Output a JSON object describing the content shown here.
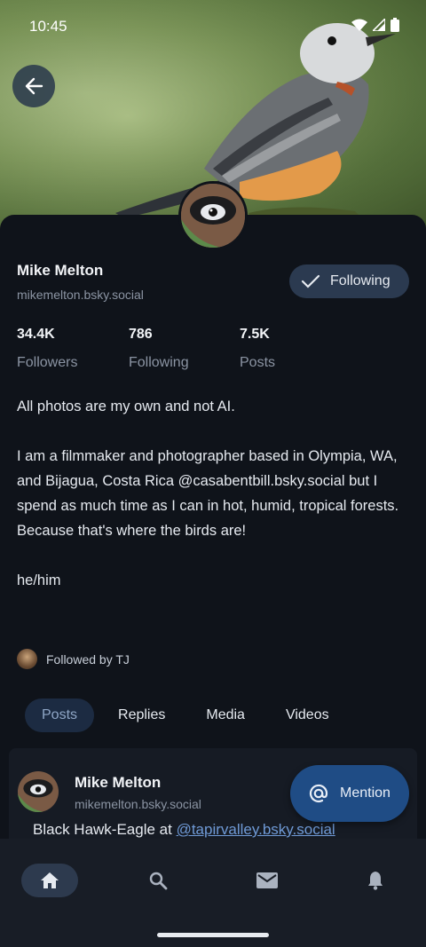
{
  "status_bar": {
    "time": "10:45"
  },
  "profile": {
    "name": "Mike Melton",
    "handle": "mikemelton.bsky.social",
    "follow_button_label": "Following",
    "stats": [
      {
        "value": "34.4K",
        "label": "Followers"
      },
      {
        "value": "786",
        "label": "Following"
      },
      {
        "value": "7.5K",
        "label": "Posts"
      }
    ],
    "bio": "All photos are my own and not AI.\n\nI am a filmmaker and photographer based in Olympia, WA, and Bijagua, Costa Rica @casabentbill.bsky.social but I spend as much time as I can in hot, humid, tropical forests. Because that's where the birds are!\n\nhe/him",
    "followed_by": "Followed by TJ"
  },
  "tabs": [
    "Posts",
    "Replies",
    "Media",
    "Videos"
  ],
  "active_tab": "Posts",
  "post": {
    "author_name": "Mike Melton",
    "author_handle": "mikemelton.bsky.social",
    "text_prefix": "Black Hawk-Eagle at ",
    "text_link": "@tapirvalley.bsky.social"
  },
  "fab": {
    "label": "Mention",
    "icon": "at-icon"
  },
  "bottom_nav": [
    {
      "icon": "home-icon",
      "active": true
    },
    {
      "icon": "search-icon",
      "active": false
    },
    {
      "icon": "mail-icon",
      "active": false
    },
    {
      "icon": "bell-icon",
      "active": false
    }
  ],
  "colors": {
    "accent": "#1f4c85",
    "background": "#0f131a",
    "link": "#6f9ad6"
  }
}
